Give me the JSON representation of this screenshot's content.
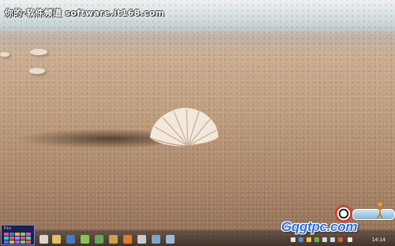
{
  "wallpaper": {
    "description_icon": "seashell-on-beach-wallpaper"
  },
  "watermark": {
    "text": "你的·软件频道 software.it168.com"
  },
  "start_tile": {
    "label": "Pin"
  },
  "taskbar": {
    "icons": [
      "explorer-icon",
      "folder-icon",
      "media-icon",
      "browser-icon",
      "app-icon",
      "app-icon",
      "media-player-icon",
      "settings-icon",
      "app-icon",
      "app-icon"
    ],
    "clock": "14:14"
  },
  "site_logo": {
    "text": "Gqgtpc.com"
  },
  "colors": {
    "logo_blue": "#2a6fe0",
    "badge_red": "#d83a2a"
  }
}
